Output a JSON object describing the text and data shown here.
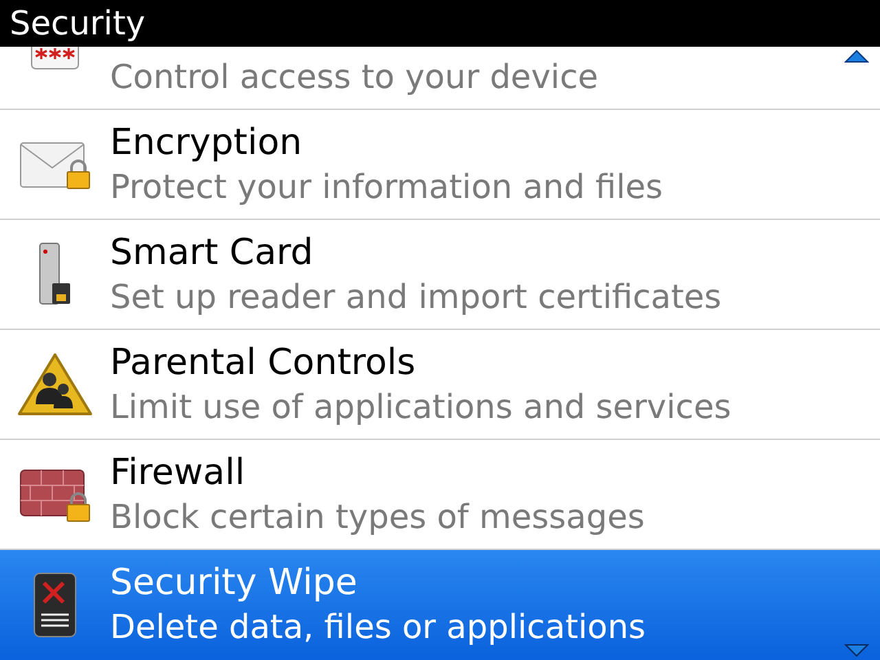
{
  "window": {
    "title": "Security"
  },
  "items": [
    {
      "kind": "password",
      "title_visible": false,
      "subtitle": "Control access to your device",
      "selected": false
    },
    {
      "kind": "encryption",
      "title": "Encryption",
      "subtitle": "Protect your information and files",
      "selected": false
    },
    {
      "kind": "smartcard",
      "title": "Smart Card",
      "subtitle": "Set up reader and import certificates",
      "selected": false
    },
    {
      "kind": "parental",
      "title": "Parental Controls",
      "subtitle": "Limit use of applications and services",
      "selected": false
    },
    {
      "kind": "firewall",
      "title": "Firewall",
      "subtitle": "Block certain types of messages",
      "selected": false
    },
    {
      "kind": "wipe",
      "title": "Security Wipe",
      "subtitle": "Delete data, files or applications",
      "selected": true
    }
  ]
}
